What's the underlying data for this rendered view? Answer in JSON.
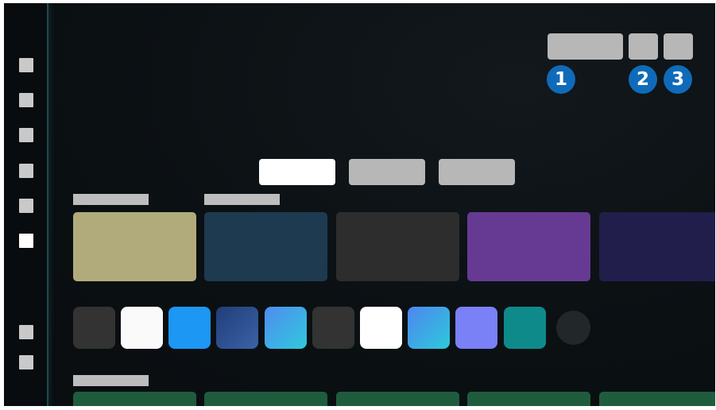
{
  "colors": {
    "background": "#0b1013",
    "sidebar": "#080c0e",
    "badge": "#0f6bb9",
    "placeholder": "#b7b7b7"
  },
  "sidebar": {
    "items": [
      {
        "icon": "placeholder-square",
        "active": false
      },
      {
        "icon": "placeholder-square",
        "active": false
      },
      {
        "icon": "placeholder-square",
        "active": false
      },
      {
        "icon": "placeholder-square",
        "active": false
      },
      {
        "icon": "placeholder-square",
        "active": false
      },
      {
        "icon": "placeholder-square",
        "active": true
      },
      {
        "icon": "placeholder-square",
        "active": false
      },
      {
        "icon": "placeholder-square",
        "active": false
      }
    ]
  },
  "header": {
    "callouts": [
      {
        "number": "1"
      },
      {
        "number": "2"
      },
      {
        "number": "3"
      }
    ]
  },
  "tabs": [
    {
      "active": true
    },
    {
      "active": false
    },
    {
      "active": false
    }
  ],
  "content_cards": [
    {
      "color": "#b1ab7c"
    },
    {
      "color": "#1d3a50"
    },
    {
      "color": "#2d2d2d"
    },
    {
      "color": "#663a93"
    },
    {
      "color": "#211e4c"
    }
  ],
  "apps": [
    {
      "color": "#333333"
    },
    {
      "color": "#fafafa"
    },
    {
      "color": "#1c97f3"
    },
    {
      "color": "#2d4e91"
    },
    {
      "color": "#42a6e6"
    },
    {
      "color": "#333333"
    },
    {
      "color": "#ffffff"
    },
    {
      "color": "#3fa0e2"
    },
    {
      "color": "#7a80f6"
    },
    {
      "color": "#0f8a8a"
    }
  ],
  "bottom_row": {
    "color": "#1f5c3d",
    "count": 5
  }
}
